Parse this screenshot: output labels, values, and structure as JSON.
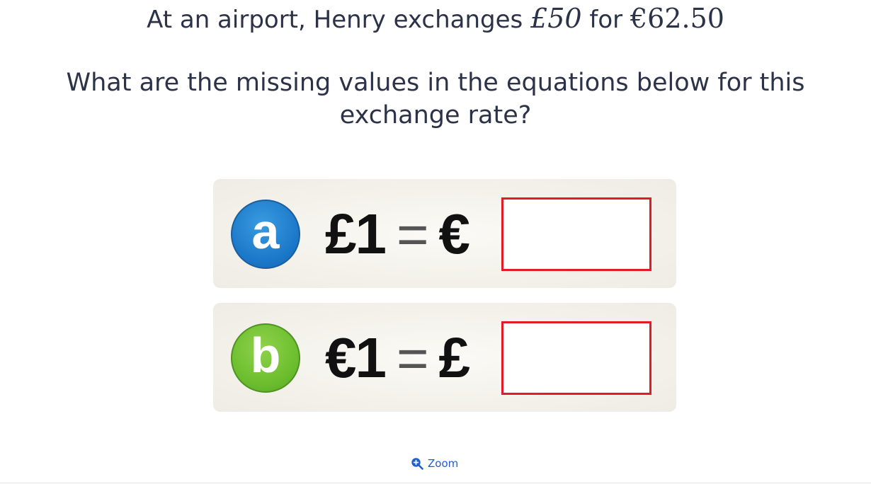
{
  "intro": {
    "prefix": "At an airport, Henry exchanges ",
    "amount_pounds": "£50",
    "connector": " for ",
    "amount_euros": "€62.50"
  },
  "question": "What are the missing values in the equations below for this exchange rate?",
  "parts": [
    {
      "letter": "a",
      "equation_left": "£1",
      "equals": "=",
      "currency": "€",
      "answer_value": "",
      "badge_color": "#1b78c9"
    },
    {
      "letter": "b",
      "equation_left": "€1",
      "equals": "=",
      "currency": "£",
      "answer_value": "",
      "badge_color": "#6bbd2e"
    }
  ],
  "answer_box_border_color": "#e21b24",
  "zoom": {
    "label": "Zoom",
    "icon": "zoom-in-icon",
    "color": "#1e5fcc"
  }
}
